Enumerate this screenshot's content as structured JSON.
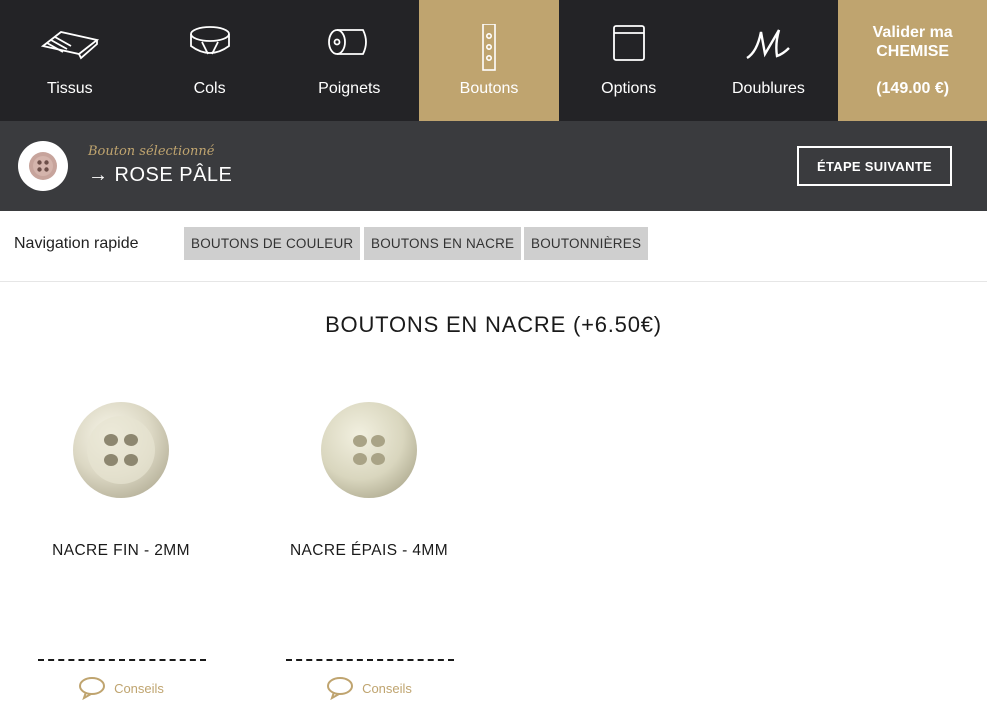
{
  "nav": {
    "items": [
      {
        "label": "Tissus",
        "icon": "fabric-icon"
      },
      {
        "label": "Cols",
        "icon": "collar-icon"
      },
      {
        "label": "Poignets",
        "icon": "cuff-icon"
      },
      {
        "label": "Boutons",
        "icon": "buttons-icon",
        "active": true
      },
      {
        "label": "Options",
        "icon": "options-icon"
      },
      {
        "label": "Doublures",
        "icon": "monogram-icon"
      }
    ],
    "validate": {
      "line1": "Valider ma",
      "line2": "CHEMISE",
      "price": "(149.00 €)"
    }
  },
  "selected": {
    "caption": "Bouton sélectionné",
    "arrow": "→",
    "value": "ROSE PÂLE",
    "next_label": "ÉTAPE SUIVANTE"
  },
  "quicknav": {
    "label": "Navigation rapide",
    "tags": [
      "BOUTONS DE COULEUR",
      "BOUTONS EN NACRE",
      "BOUTONNIÈRES"
    ]
  },
  "section": {
    "title": "BOUTONS EN NACRE (+6.50€)",
    "products": [
      {
        "name": "NACRE FIN - 2MM",
        "conseils": "Conseils"
      },
      {
        "name": "NACRE ÉPAIS - 4MM",
        "conseils": "Conseils"
      }
    ]
  },
  "colors": {
    "dark": "#232326",
    "gold": "#bfa46f",
    "bar": "#3a3b3e",
    "tag": "#cfcfcf"
  }
}
